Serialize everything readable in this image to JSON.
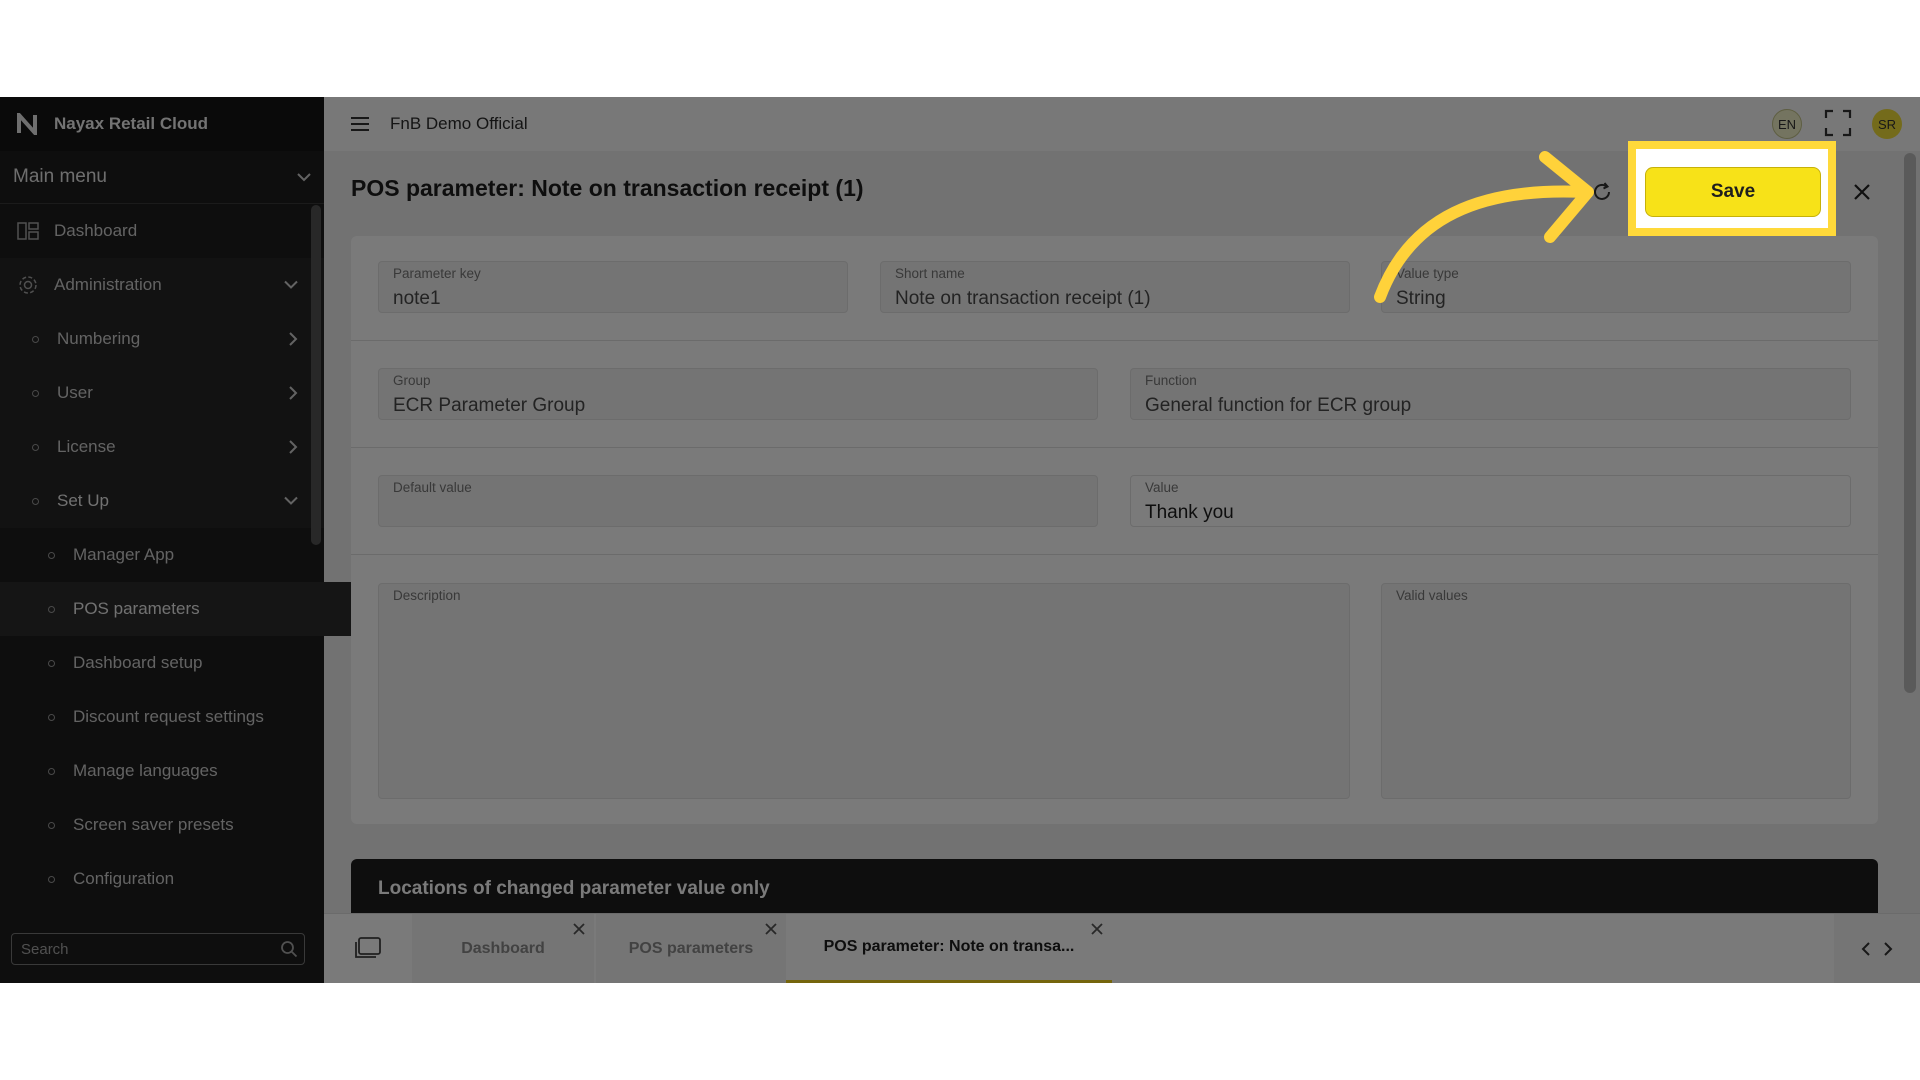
{
  "app": {
    "name": "Nayax Retail Cloud",
    "company": "FnB Demo Official",
    "language": "EN",
    "user_initials": "SR"
  },
  "sidebar": {
    "main_menu_label": "Main menu",
    "items": [
      {
        "label": "Dashboard",
        "icon": "dashboard-icon"
      },
      {
        "label": "Administration",
        "icon": "gear-icon"
      },
      {
        "label": "Numbering"
      },
      {
        "label": "User"
      },
      {
        "label": "License"
      },
      {
        "label": "Set Up"
      },
      {
        "label": "Manager App"
      },
      {
        "label": "POS parameters"
      },
      {
        "label": "Dashboard setup"
      },
      {
        "label": "Discount request settings"
      },
      {
        "label": "Manage languages"
      },
      {
        "label": "Screen saver presets"
      },
      {
        "label": "Configuration"
      }
    ],
    "search_placeholder": "Search"
  },
  "page": {
    "title": "POS parameter: Note on transaction receipt (1)",
    "save_label": "Save",
    "fields": {
      "parameter_key": {
        "label": "Parameter key",
        "value": "note1"
      },
      "short_name": {
        "label": "Short name",
        "value": "Note on transaction receipt (1)"
      },
      "value_type": {
        "label": "Value type",
        "value": "String"
      },
      "group": {
        "label": "Group",
        "value": "ECR Parameter Group"
      },
      "function": {
        "label": "Function",
        "value": "General function for ECR group"
      },
      "default_value": {
        "label": "Default value",
        "value": ""
      },
      "value": {
        "label": "Value",
        "value": "Thank you"
      },
      "description": {
        "label": "Description",
        "value": ""
      },
      "valid_values": {
        "label": "Valid values",
        "value": ""
      }
    },
    "section_title": "Locations of changed parameter value only"
  },
  "tabs": [
    {
      "label": "Dashboard"
    },
    {
      "label": "POS parameters"
    },
    {
      "label": "POS parameter: Note on transa..."
    }
  ],
  "colors": {
    "accent": "#f7e218",
    "highlight": "#ffd93a",
    "sidebar_bg": "#1e1e1e"
  }
}
